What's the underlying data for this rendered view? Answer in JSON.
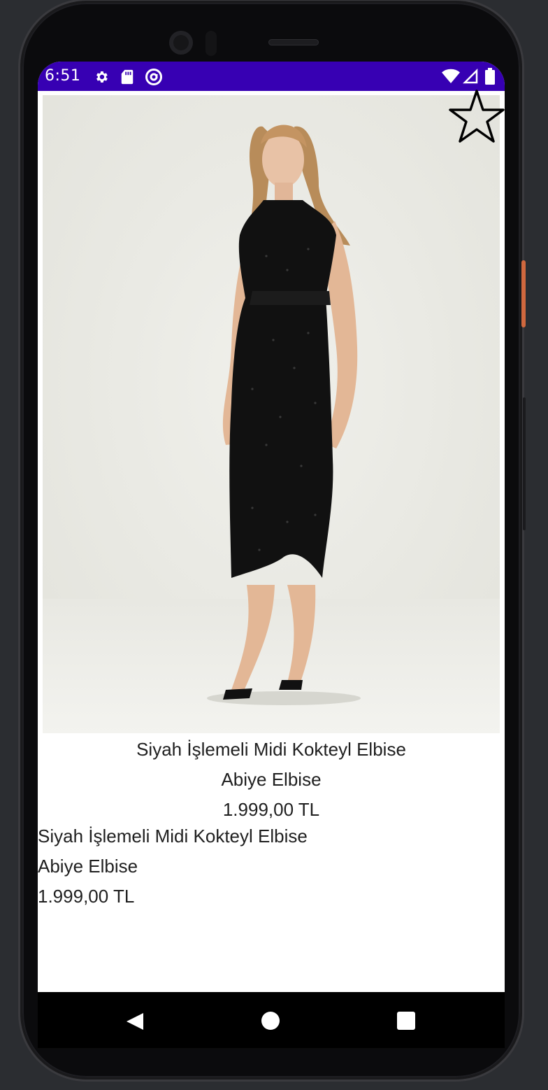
{
  "status_bar": {
    "time": "6:51",
    "icons": [
      "settings-gear-icon",
      "sd-card-icon",
      "at-sign-icon",
      "wifi-icon",
      "signal-icon",
      "battery-icon"
    ],
    "background_color": "#3700b3"
  },
  "product": {
    "image_description_icon": "product-photo",
    "favorite_icon": "star-outline-icon",
    "centered": {
      "name": "Siyah İşlemeli Midi Kokteyl Elbise",
      "category": "Abiye Elbise",
      "price": "1.999,00 TL"
    },
    "left_aligned": {
      "name": "Siyah İşlemeli Midi Kokteyl Elbise",
      "category": "Abiye Elbise",
      "price": "1.999,00 TL"
    }
  },
  "nav_bar": {
    "icons": [
      "back-icon",
      "home-icon",
      "recents-icon"
    ]
  }
}
